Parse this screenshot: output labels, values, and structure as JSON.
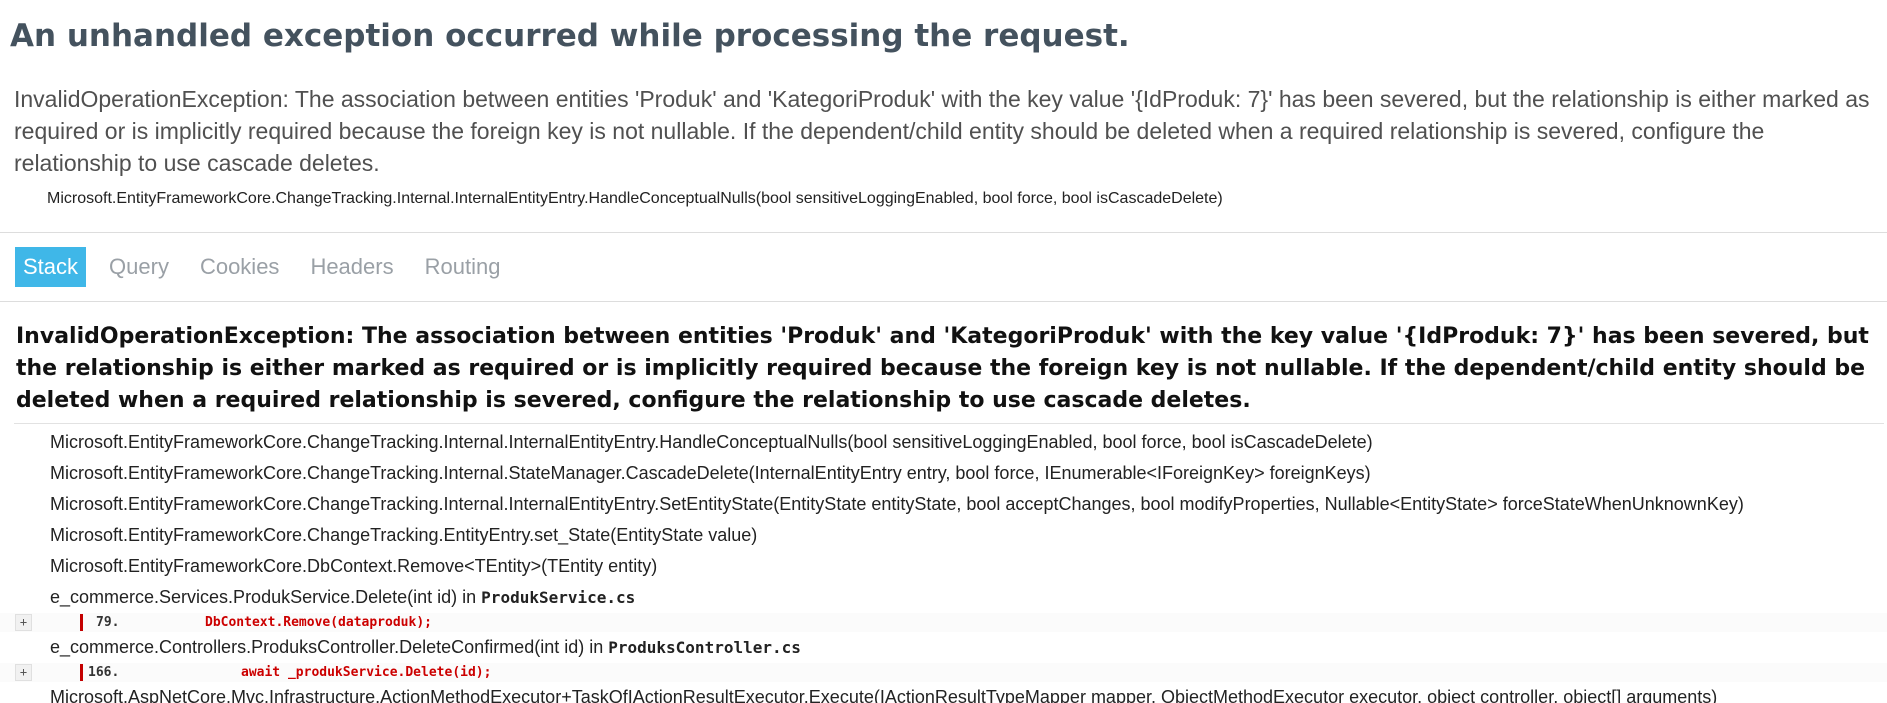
{
  "page": {
    "title": "An unhandled exception occurred while processing the request.",
    "summary": "InvalidOperationException: The association between entities 'Produk' and 'KategoriProduk' with the key value '{IdProduk: 7}' has been severed, but the relationship is either marked as required or is implicitly required because the foreign key is not nullable. If the dependent/child entity should be deleted when a required relationship is severed, configure the relationship to use cascade deletes.",
    "location": "Microsoft.EntityFrameworkCore.ChangeTracking.Internal.InternalEntityEntry.HandleConceptualNulls(bool sensitiveLoggingEnabled, bool force, bool isCascadeDelete)"
  },
  "tabs": [
    {
      "label": "Stack",
      "active": true
    },
    {
      "label": "Query",
      "active": false
    },
    {
      "label": "Cookies",
      "active": false
    },
    {
      "label": "Headers",
      "active": false
    },
    {
      "label": "Routing",
      "active": false
    }
  ],
  "stack": {
    "exception_title": "InvalidOperationException: The association between entities 'Produk' and 'KategoriProduk' with the key value '{IdProduk: 7}' has been severed, but the relationship is either marked as required or is implicitly required because the foreign key is not nullable. If the dependent/child entity should be deleted when a required relationship is severed, configure the relationship to use cascade deletes.",
    "frames": [
      {
        "method": "Microsoft.EntityFrameworkCore.ChangeTracking.Internal.InternalEntityEntry.HandleConceptualNulls(bool sensitiveLoggingEnabled, bool force, bool isCascadeDelete)"
      },
      {
        "method": "Microsoft.EntityFrameworkCore.ChangeTracking.Internal.StateManager.CascadeDelete(InternalEntityEntry entry, bool force, IEnumerable<IForeignKey> foreignKeys)"
      },
      {
        "method": "Microsoft.EntityFrameworkCore.ChangeTracking.Internal.InternalEntityEntry.SetEntityState(EntityState entityState, bool acceptChanges, bool modifyProperties, Nullable<EntityState> forceStateWhenUnknownKey)"
      },
      {
        "method": "Microsoft.EntityFrameworkCore.ChangeTracking.EntityEntry.set_State(EntityState value)"
      },
      {
        "method": "Microsoft.EntityFrameworkCore.DbContext.Remove<TEntity>(TEntity entity)"
      },
      {
        "method": "e_commerce.Services.ProdukService.Delete(int id)",
        "in_label": " in ",
        "file": "ProdukService.cs",
        "source": {
          "expander": "+",
          "line": "79.",
          "code": "DbContext.Remove(dataproduk);"
        }
      },
      {
        "method": "e_commerce.Controllers.ProduksController.DeleteConfirmed(int id)",
        "in_label": " in ",
        "file": "ProduksController.cs",
        "source": {
          "expander": "+",
          "line": "166.",
          "code": "await _produkService.Delete(id);"
        }
      },
      {
        "method": "Microsoft.AspNetCore.Mvc.Infrastructure.ActionMethodExecutor+TaskOfIActionResultExecutor.Execute(IActionResultTypeMapper mapper, ObjectMethodExecutor executor, object controller, object[] arguments)"
      }
    ]
  }
}
